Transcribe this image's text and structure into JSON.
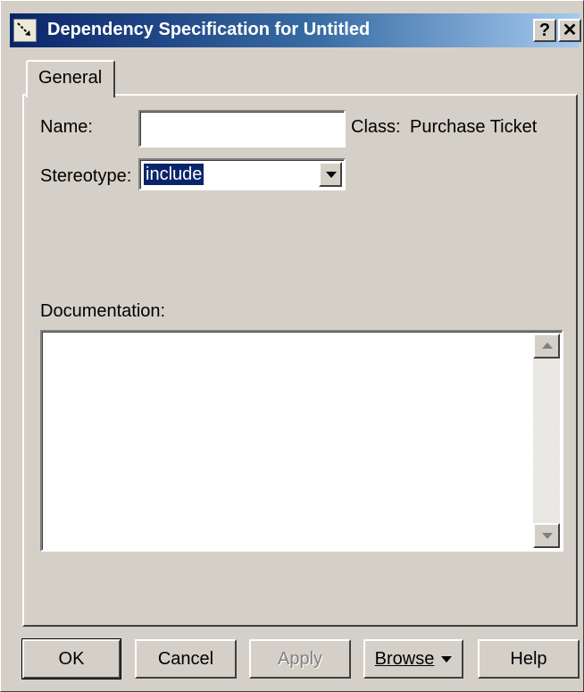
{
  "window": {
    "title": "Dependency Specification for Untitled",
    "help_glyph": "?",
    "close_glyph": "✕"
  },
  "tabs": [
    {
      "label": "General",
      "active": true
    }
  ],
  "form": {
    "name_label": "Name:",
    "name_value": "",
    "class_label": "Class:",
    "class_value": "Purchase Ticket",
    "stereotype_label": "Stereotype:",
    "stereotype_value": "include",
    "documentation_label": "Documentation:",
    "documentation_value": ""
  },
  "buttons": {
    "ok": "OK",
    "cancel": "Cancel",
    "apply": "Apply",
    "browse": "Browse",
    "help": "Help"
  },
  "icons": {
    "title_icon": "dependency-icon",
    "dropdown": "chevron-down-icon",
    "scroll_up": "scroll-up-icon",
    "scroll_down": "scroll-down-icon"
  },
  "colors": {
    "titlebar_start": "#0a246a",
    "titlebar_end": "#a6caf0",
    "face": "#d4d0c8",
    "selection": "#0a246a"
  }
}
